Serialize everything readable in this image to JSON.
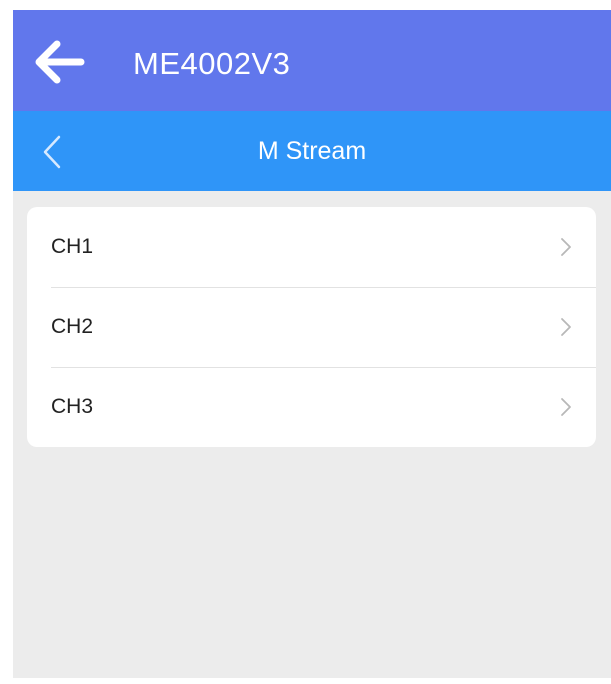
{
  "app_bar": {
    "title": "ME4002V3",
    "back_icon": "arrow-left-icon",
    "color": "#6177ec"
  },
  "sub_bar": {
    "title": "M Stream",
    "back_icon": "chevron-left-icon",
    "color": "#2f95f8"
  },
  "channels": {
    "items": [
      {
        "label": "CH1",
        "icon": "chevron-right-icon"
      },
      {
        "label": "CH2",
        "icon": "chevron-right-icon"
      },
      {
        "label": "CH3",
        "icon": "chevron-right-icon"
      }
    ]
  },
  "background_color": "#ececec"
}
